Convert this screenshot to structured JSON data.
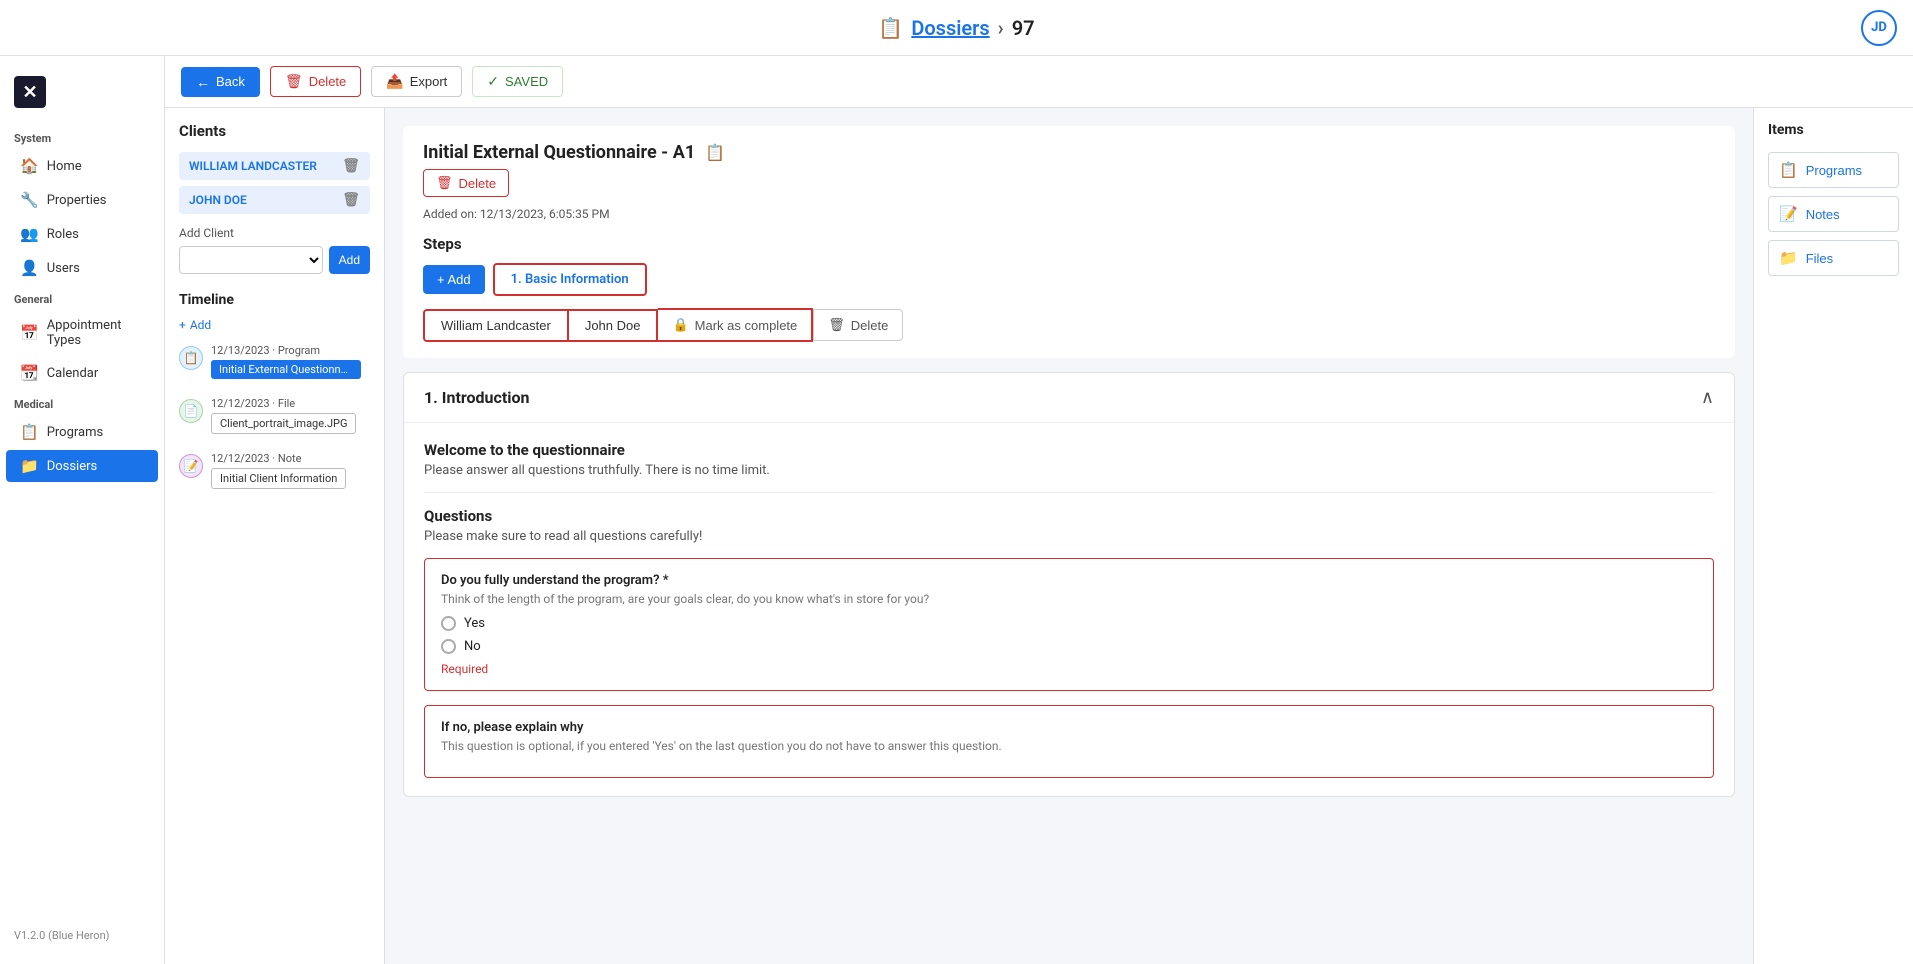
{
  "topBar": {
    "icon": "📋",
    "breadcrumb_link": "Dossiers",
    "separator": "›",
    "dossier_id": "97",
    "avatar_initials": "JD"
  },
  "sidebar": {
    "system_label": "System",
    "general_label": "General",
    "medical_label": "Medical",
    "items": [
      {
        "id": "home",
        "label": "Home",
        "icon": "🏠",
        "active": false
      },
      {
        "id": "properties",
        "label": "Properties",
        "icon": "🔧",
        "active": false
      },
      {
        "id": "roles",
        "label": "Roles",
        "icon": "👥",
        "active": false
      },
      {
        "id": "users",
        "label": "Users",
        "icon": "👤",
        "active": false
      },
      {
        "id": "appointment-types",
        "label": "Appointment Types",
        "icon": "📅",
        "active": false
      },
      {
        "id": "calendar",
        "label": "Calendar",
        "icon": "📆",
        "active": false
      },
      {
        "id": "programs",
        "label": "Programs",
        "icon": "📋",
        "active": false
      },
      {
        "id": "dossiers",
        "label": "Dossiers",
        "icon": "📁",
        "active": true
      }
    ],
    "version": "V1.2.0 (Blue Heron)"
  },
  "toolbar": {
    "back_label": "Back",
    "delete_label": "Delete",
    "export_label": "Export",
    "saved_label": "SAVED"
  },
  "clients_panel": {
    "title": "Clients",
    "clients": [
      {
        "name": "WILLIAM LANDCASTER"
      },
      {
        "name": "JOHN DOE"
      }
    ],
    "add_client_label": "Add Client",
    "add_button_label": "Add"
  },
  "timeline": {
    "title": "Timeline",
    "add_label": "+ Add",
    "items": [
      {
        "type": "program",
        "date": "12/13/2023 · Program",
        "chip_label": "Initial External Questionnaire - A",
        "icon": "📋"
      },
      {
        "type": "file",
        "date": "12/12/2023 · File",
        "chip_label": "Client_portrait_image.JPG",
        "icon": "📄"
      },
      {
        "type": "note",
        "date": "12/12/2023 · Note",
        "chip_label": "Initial Client Information",
        "icon": "📝"
      }
    ]
  },
  "questionnaire": {
    "title": "Initial External Questionnaire - A1",
    "copy_icon": "📋",
    "delete_label": "Delete",
    "added_on": "Added on: 12/13/2023, 6:05:35 PM",
    "steps_label": "Steps",
    "add_step_label": "+ Add",
    "step_tab_label": "1. Basic Information",
    "clients_row": [
      {
        "name": "William Landcaster"
      },
      {
        "name": "John Doe"
      }
    ],
    "mark_complete_label": "Mark as complete",
    "delete_step_label": "Delete",
    "section": {
      "title": "1. Introduction",
      "collapse_icon": "∧",
      "intro_title": "Welcome to the questionnaire",
      "intro_desc": "Please answer all questions truthfully. There is no time limit.",
      "questions_title": "Questions",
      "questions_desc": "Please make sure to read all questions carefully!",
      "question_1": {
        "text": "Do you fully understand the program? *",
        "hint": "Think of the length of the program, are your goals clear, do you know what's in store for you?",
        "options": [
          "Yes",
          "No"
        ],
        "required_label": "Required"
      },
      "question_2": {
        "text": "If no, please explain why",
        "hint": "This question is optional, if you entered 'Yes' on the last question you do not have to answer this question."
      }
    }
  },
  "right_panel": {
    "title": "Items",
    "items": [
      {
        "id": "programs",
        "label": "Programs",
        "icon": "📋"
      },
      {
        "id": "notes",
        "label": "Notes",
        "icon": "📝"
      },
      {
        "id": "files",
        "label": "Files",
        "icon": "📁"
      }
    ]
  }
}
